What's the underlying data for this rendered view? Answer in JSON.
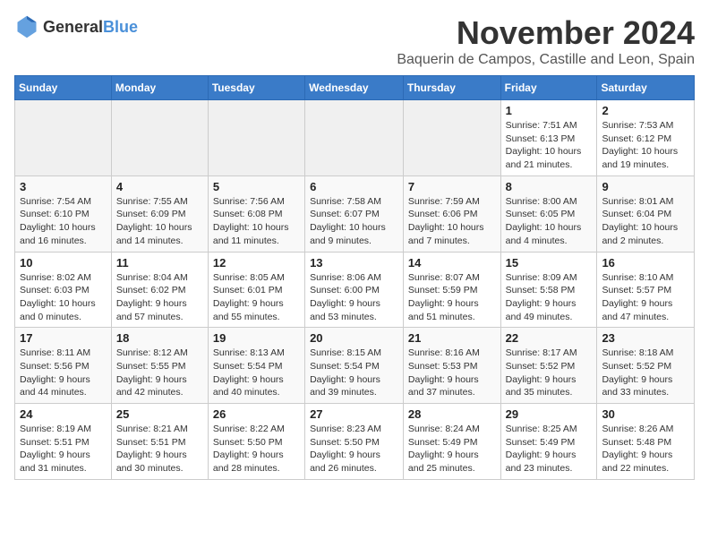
{
  "logo": {
    "general": "General",
    "blue": "Blue"
  },
  "title": "November 2024",
  "location": "Baquerin de Campos, Castille and Leon, Spain",
  "headers": [
    "Sunday",
    "Monday",
    "Tuesday",
    "Wednesday",
    "Thursday",
    "Friday",
    "Saturday"
  ],
  "weeks": [
    [
      {
        "day": "",
        "empty": true
      },
      {
        "day": "",
        "empty": true
      },
      {
        "day": "",
        "empty": true
      },
      {
        "day": "",
        "empty": true
      },
      {
        "day": "",
        "empty": true
      },
      {
        "day": "1",
        "sunrise": "Sunrise: 7:51 AM",
        "sunset": "Sunset: 6:13 PM",
        "daylight": "Daylight: 10 hours and 21 minutes."
      },
      {
        "day": "2",
        "sunrise": "Sunrise: 7:53 AM",
        "sunset": "Sunset: 6:12 PM",
        "daylight": "Daylight: 10 hours and 19 minutes."
      }
    ],
    [
      {
        "day": "3",
        "sunrise": "Sunrise: 7:54 AM",
        "sunset": "Sunset: 6:10 PM",
        "daylight": "Daylight: 10 hours and 16 minutes."
      },
      {
        "day": "4",
        "sunrise": "Sunrise: 7:55 AM",
        "sunset": "Sunset: 6:09 PM",
        "daylight": "Daylight: 10 hours and 14 minutes."
      },
      {
        "day": "5",
        "sunrise": "Sunrise: 7:56 AM",
        "sunset": "Sunset: 6:08 PM",
        "daylight": "Daylight: 10 hours and 11 minutes."
      },
      {
        "day": "6",
        "sunrise": "Sunrise: 7:58 AM",
        "sunset": "Sunset: 6:07 PM",
        "daylight": "Daylight: 10 hours and 9 minutes."
      },
      {
        "day": "7",
        "sunrise": "Sunrise: 7:59 AM",
        "sunset": "Sunset: 6:06 PM",
        "daylight": "Daylight: 10 hours and 7 minutes."
      },
      {
        "day": "8",
        "sunrise": "Sunrise: 8:00 AM",
        "sunset": "Sunset: 6:05 PM",
        "daylight": "Daylight: 10 hours and 4 minutes."
      },
      {
        "day": "9",
        "sunrise": "Sunrise: 8:01 AM",
        "sunset": "Sunset: 6:04 PM",
        "daylight": "Daylight: 10 hours and 2 minutes."
      }
    ],
    [
      {
        "day": "10",
        "sunrise": "Sunrise: 8:02 AM",
        "sunset": "Sunset: 6:03 PM",
        "daylight": "Daylight: 10 hours and 0 minutes."
      },
      {
        "day": "11",
        "sunrise": "Sunrise: 8:04 AM",
        "sunset": "Sunset: 6:02 PM",
        "daylight": "Daylight: 9 hours and 57 minutes."
      },
      {
        "day": "12",
        "sunrise": "Sunrise: 8:05 AM",
        "sunset": "Sunset: 6:01 PM",
        "daylight": "Daylight: 9 hours and 55 minutes."
      },
      {
        "day": "13",
        "sunrise": "Sunrise: 8:06 AM",
        "sunset": "Sunset: 6:00 PM",
        "daylight": "Daylight: 9 hours and 53 minutes."
      },
      {
        "day": "14",
        "sunrise": "Sunrise: 8:07 AM",
        "sunset": "Sunset: 5:59 PM",
        "daylight": "Daylight: 9 hours and 51 minutes."
      },
      {
        "day": "15",
        "sunrise": "Sunrise: 8:09 AM",
        "sunset": "Sunset: 5:58 PM",
        "daylight": "Daylight: 9 hours and 49 minutes."
      },
      {
        "day": "16",
        "sunrise": "Sunrise: 8:10 AM",
        "sunset": "Sunset: 5:57 PM",
        "daylight": "Daylight: 9 hours and 47 minutes."
      }
    ],
    [
      {
        "day": "17",
        "sunrise": "Sunrise: 8:11 AM",
        "sunset": "Sunset: 5:56 PM",
        "daylight": "Daylight: 9 hours and 44 minutes."
      },
      {
        "day": "18",
        "sunrise": "Sunrise: 8:12 AM",
        "sunset": "Sunset: 5:55 PM",
        "daylight": "Daylight: 9 hours and 42 minutes."
      },
      {
        "day": "19",
        "sunrise": "Sunrise: 8:13 AM",
        "sunset": "Sunset: 5:54 PM",
        "daylight": "Daylight: 9 hours and 40 minutes."
      },
      {
        "day": "20",
        "sunrise": "Sunrise: 8:15 AM",
        "sunset": "Sunset: 5:54 PM",
        "daylight": "Daylight: 9 hours and 39 minutes."
      },
      {
        "day": "21",
        "sunrise": "Sunrise: 8:16 AM",
        "sunset": "Sunset: 5:53 PM",
        "daylight": "Daylight: 9 hours and 37 minutes."
      },
      {
        "day": "22",
        "sunrise": "Sunrise: 8:17 AM",
        "sunset": "Sunset: 5:52 PM",
        "daylight": "Daylight: 9 hours and 35 minutes."
      },
      {
        "day": "23",
        "sunrise": "Sunrise: 8:18 AM",
        "sunset": "Sunset: 5:52 PM",
        "daylight": "Daylight: 9 hours and 33 minutes."
      }
    ],
    [
      {
        "day": "24",
        "sunrise": "Sunrise: 8:19 AM",
        "sunset": "Sunset: 5:51 PM",
        "daylight": "Daylight: 9 hours and 31 minutes."
      },
      {
        "day": "25",
        "sunrise": "Sunrise: 8:21 AM",
        "sunset": "Sunset: 5:51 PM",
        "daylight": "Daylight: 9 hours and 30 minutes."
      },
      {
        "day": "26",
        "sunrise": "Sunrise: 8:22 AM",
        "sunset": "Sunset: 5:50 PM",
        "daylight": "Daylight: 9 hours and 28 minutes."
      },
      {
        "day": "27",
        "sunrise": "Sunrise: 8:23 AM",
        "sunset": "Sunset: 5:50 PM",
        "daylight": "Daylight: 9 hours and 26 minutes."
      },
      {
        "day": "28",
        "sunrise": "Sunrise: 8:24 AM",
        "sunset": "Sunset: 5:49 PM",
        "daylight": "Daylight: 9 hours and 25 minutes."
      },
      {
        "day": "29",
        "sunrise": "Sunrise: 8:25 AM",
        "sunset": "Sunset: 5:49 PM",
        "daylight": "Daylight: 9 hours and 23 minutes."
      },
      {
        "day": "30",
        "sunrise": "Sunrise: 8:26 AM",
        "sunset": "Sunset: 5:48 PM",
        "daylight": "Daylight: 9 hours and 22 minutes."
      }
    ]
  ]
}
